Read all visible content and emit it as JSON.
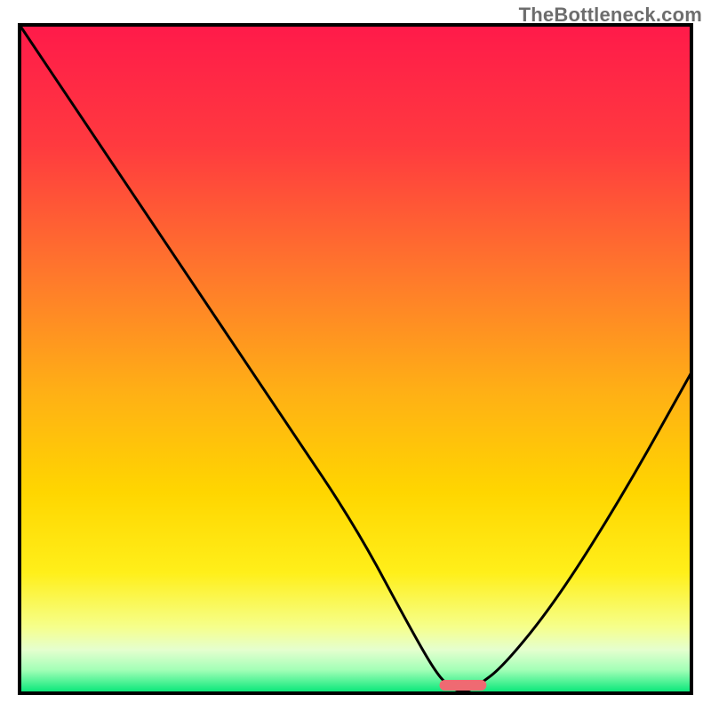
{
  "attribution": "TheBottleneck.com",
  "colors": {
    "gradient_stops": [
      {
        "offset": 0.0,
        "color": "#ff1a4a"
      },
      {
        "offset": 0.18,
        "color": "#ff3a3f"
      },
      {
        "offset": 0.38,
        "color": "#ff7a2b"
      },
      {
        "offset": 0.55,
        "color": "#ffb015"
      },
      {
        "offset": 0.7,
        "color": "#ffd600"
      },
      {
        "offset": 0.82,
        "color": "#ffef1a"
      },
      {
        "offset": 0.9,
        "color": "#f6ff8a"
      },
      {
        "offset": 0.935,
        "color": "#e5ffcf"
      },
      {
        "offset": 0.965,
        "color": "#a3ffb7"
      },
      {
        "offset": 1.0,
        "color": "#00e676"
      }
    ],
    "marker": "#ef6a72",
    "curve": "#000000",
    "frame": "#000000"
  },
  "chart_data": {
    "type": "line",
    "title": "",
    "xlabel": "",
    "ylabel": "",
    "xlim": [
      0,
      100
    ],
    "ylim": [
      0,
      100
    ],
    "x": [
      0,
      10,
      20,
      22,
      30,
      40,
      50,
      58,
      62,
      64,
      66,
      68,
      72,
      80,
      90,
      100
    ],
    "values": [
      100,
      85,
      70,
      67,
      55,
      40,
      25,
      10,
      3,
      1,
      0,
      1,
      4,
      14,
      30,
      48
    ],
    "marker": {
      "x_center": 66,
      "width": 7
    }
  }
}
